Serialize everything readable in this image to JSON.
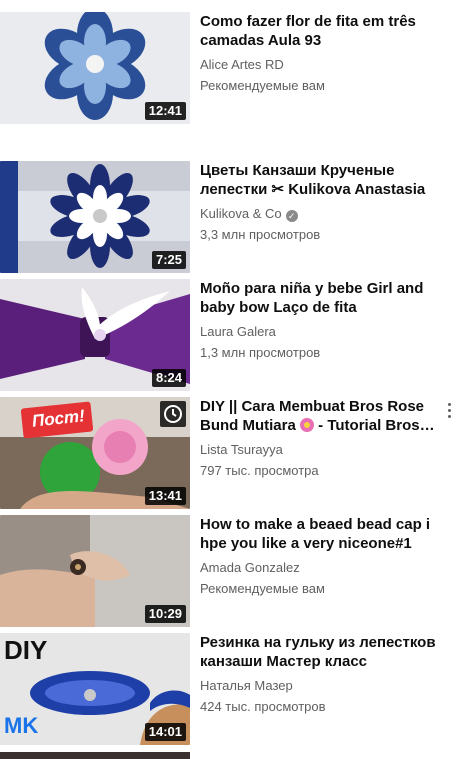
{
  "videos": [
    {
      "title": "Como fazer flor de fita em três camadas Aula 93",
      "channel": "Alice Artes RD",
      "meta": "Рекомендуемые вам",
      "duration": "12:41"
    },
    {
      "title": "Цветы Канзаши Крученые лепестки ✂ Kulikova Anastasia",
      "channel": "Kulikova & Co",
      "meta": "3,3 млн просмотров",
      "duration": "7:25",
      "verified": "✓"
    },
    {
      "title": "Moño para niña y bebe Girl and baby bow Laço de fita",
      "channel": "Laura Galera",
      "meta": "1,3 млн просмотров",
      "duration": "8:24"
    },
    {
      "title_part1": "DIY || Cara Membuat Bros Rose Bund Mutiara",
      "title_part2": " - Tutorial Bros Mawar Pita Satin",
      "channel": "Lista Tsurayya",
      "meta": "797 тыс. просмотра",
      "duration": "13:41",
      "thumb_text": "Пост!"
    },
    {
      "title": "How to make a beaed bead cap i hpe you like a very niceone#1",
      "channel": "Amada Gonzalez",
      "meta": "Рекомендуемые вам",
      "duration": "10:29"
    },
    {
      "title": "Резинка на гульку из лепестков канзаши Мастер класс",
      "channel": "Наталья Мазер",
      "meta": "424 тыс. просмотров",
      "duration": "14:01",
      "thumb_text_top": "DIY",
      "thumb_text_bottom": "MK"
    }
  ],
  "colors": {
    "title": "#0f0f0f",
    "secondary": "#606060",
    "duration_bg": "#000000"
  }
}
